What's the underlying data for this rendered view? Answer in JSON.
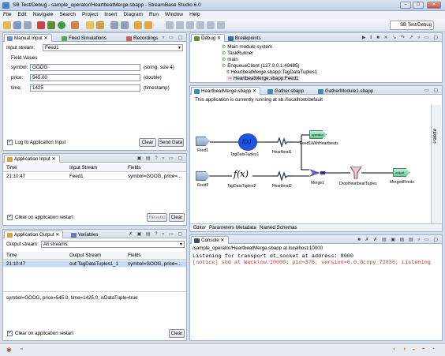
{
  "window": {
    "title": "SB Test/Debug - sample_operator/HeartbeatMerge.sbapp - StreamBase Studio 6.0",
    "min": "–",
    "max": "□",
    "close": "✕"
  },
  "menu": [
    "File",
    "Edit",
    "Navigate",
    "Search",
    "Project",
    "Insert",
    "Diagram",
    "Run",
    "Window",
    "Help"
  ],
  "perspective": "SB Test/Debug",
  "manual_input": {
    "tabs": [
      "Manual Input",
      "Feed Simulations",
      "Recordings"
    ],
    "input_stream_label": "Input stream:",
    "input_stream_value": "Feed1",
    "field_values_label": "Field Values",
    "fields": [
      {
        "name": "symbol:",
        "value": "GOOG",
        "type": "(string, size 4)"
      },
      {
        "name": "price:",
        "value": "545.00",
        "type": "(double)"
      },
      {
        "name": "time:",
        "value": "1425",
        "type": "(timestamp)"
      }
    ],
    "log_label": "Log to Application Input",
    "clear_label": "Clear",
    "send_label": "Send Data"
  },
  "app_input": {
    "tab": "Application Input",
    "columns": [
      "Time",
      "Input Stream",
      "Fields"
    ],
    "rows": [
      [
        "21:10:47",
        "Feed1",
        "symbol=GOOG, price=..."
      ]
    ],
    "clear_restart_label": "Clear on application restart",
    "resend_label": "Resend",
    "clear_label": "Clear"
  },
  "app_output": {
    "tabs": [
      "Application Output",
      "Variables"
    ],
    "output_stream_label": "Output stream:",
    "output_stream_value": "All streams",
    "columns": [
      "Time",
      "Output Stream",
      "Fields"
    ],
    "rows": [
      [
        "21:10:47",
        "out:TagDataTuples1_1",
        "symbol=GOOG, price=..."
      ]
    ],
    "detail": "symbol=GOOG, price=545.0, time=1425.0, isDataTuple=true",
    "clear_restart_label": "Clear on application restart",
    "clear_label": "Clear"
  },
  "debug": {
    "tabs": [
      "Debug",
      "Breakpoints"
    ],
    "tree": [
      "Main module system",
      "TaskRunner",
      "main",
      "EnqueueClient (127.0.0.1:49485)",
      "HeartbeatMerge.sbapp:TagDataTuples1",
      "HeartbeatMerge.sbapp:Feed1"
    ]
  },
  "editor": {
    "tabs": [
      "HeartbeatMerge.sbapp",
      "Gather.sbapp",
      "GatherModule1.sbapp"
    ],
    "running_msg": "This application is currently running at sb://localhost/default",
    "palette": "Palette",
    "bottom_tabs": [
      "Editor",
      "Parameters",
      "Metadata",
      "Named Schemas"
    ],
    "nodes": {
      "feed1": "Feed1",
      "tag1": "TagDataTuples1",
      "heartbeat1": "Heartbeat1",
      "feed1hb": "Feed1WithHeartbeats",
      "feed2": "Feed2",
      "tag2": "TagDataTuples2",
      "heartbeat2": "Heartbeat2",
      "merge1": "Merge1",
      "drop": "DropHeartbeatTuples",
      "merged": "MergedFeeds",
      "output_label": "operator",
      "merged_box": "output"
    },
    "fx": "f(x)"
  },
  "console": {
    "tab": "Console",
    "subtitle": "/sample_operator/HeartbeatMerge.sbapp at localhost:10000",
    "lines": [
      {
        "text": "Listening for transport dt_socket at address: 8000",
        "color": "#000000"
      },
      {
        "text": "[notice] sbd at Wacklow:10000; pid=376; version=6.0.0copy_72836; Listening",
        "color": "#c0392b"
      }
    ]
  },
  "colors": {
    "accent": "#1f4fbf",
    "console_error": "#c0392b",
    "selection": "#c9ddf6"
  }
}
